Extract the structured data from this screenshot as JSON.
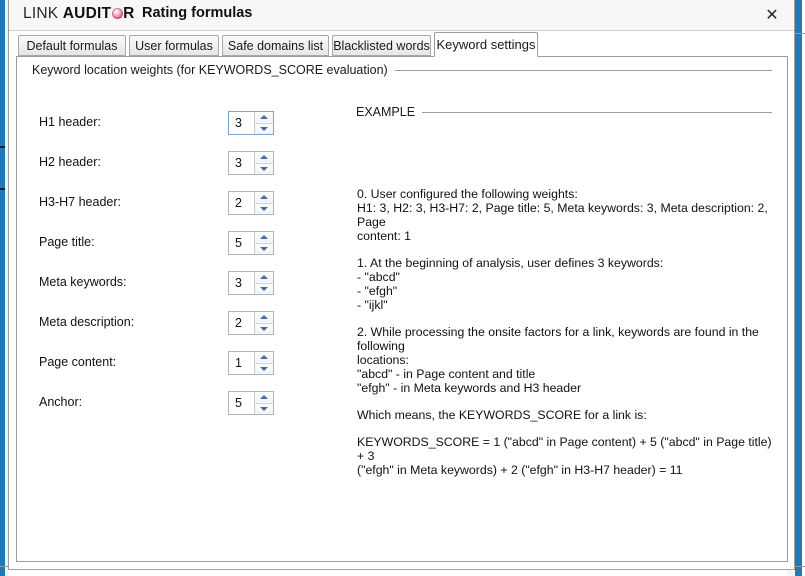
{
  "window": {
    "brand_link": "LINK",
    "brand_aud": "AUDIT",
    "brand_o_icon": "circle-logo-icon",
    "brand_r": "R",
    "dialog_title": "Rating formulas",
    "close_label": "✕",
    "accent_color": "#2079b8"
  },
  "tabs": [
    {
      "label": "Default formulas",
      "active": false
    },
    {
      "label": "User formulas",
      "active": false
    },
    {
      "label": "Safe domains list",
      "active": false
    },
    {
      "label": "Blacklisted words",
      "active": false
    },
    {
      "label": "Keyword settings",
      "active": true
    }
  ],
  "weights_group": {
    "legend": "Keyword location weights (for KEYWORDS_SCORE evaluation)",
    "rows": [
      {
        "label": "H1 header:",
        "value": "3",
        "focused": true
      },
      {
        "label": "H2 header:",
        "value": "3",
        "focused": false
      },
      {
        "label": "H3-H7 header:",
        "value": "2",
        "focused": false
      },
      {
        "label": "Page title:",
        "value": "5",
        "focused": false
      },
      {
        "label": "Meta keywords:",
        "value": "3",
        "focused": false
      },
      {
        "label": "Meta description:",
        "value": "2",
        "focused": false
      },
      {
        "label": "Page content:",
        "value": "1",
        "focused": false
      },
      {
        "label": "Anchor:",
        "value": "5",
        "focused": false
      }
    ]
  },
  "example_group": {
    "legend": "EXAMPLE",
    "paragraphs": [
      {
        "lines": [
          "0. User configured the following weights:",
          "H1: 3, H2: 3, H3-H7: 2, Page title: 5, Meta keywords: 3, Meta description: 2, Page",
          "content: 1"
        ]
      },
      {
        "lines": [
          "1. At the beginning of analysis, user defines 3 keywords:",
          "- \"abcd\"",
          "- \"efgh\"",
          "- \"ijkl\""
        ]
      },
      {
        "lines": [
          "2. While processing the onsite factors for a link, keywords are found in the following",
          "locations:",
          "\"abcd\" - in Page content and title",
          "\"efgh\" - in Meta keywords and H3 header"
        ]
      },
      {
        "lines": [
          "Which means, the KEYWORDS_SCORE for a link is:"
        ]
      },
      {
        "lines": [
          "KEYWORDS_SCORE = 1 (\"abcd\" in Page content) + 5 (\"abcd\" in Page title) + 3",
          "(\"efgh\" in Meta keywords) + 2 (\"efgh\" in H3-H7 header) = 11"
        ]
      }
    ]
  }
}
